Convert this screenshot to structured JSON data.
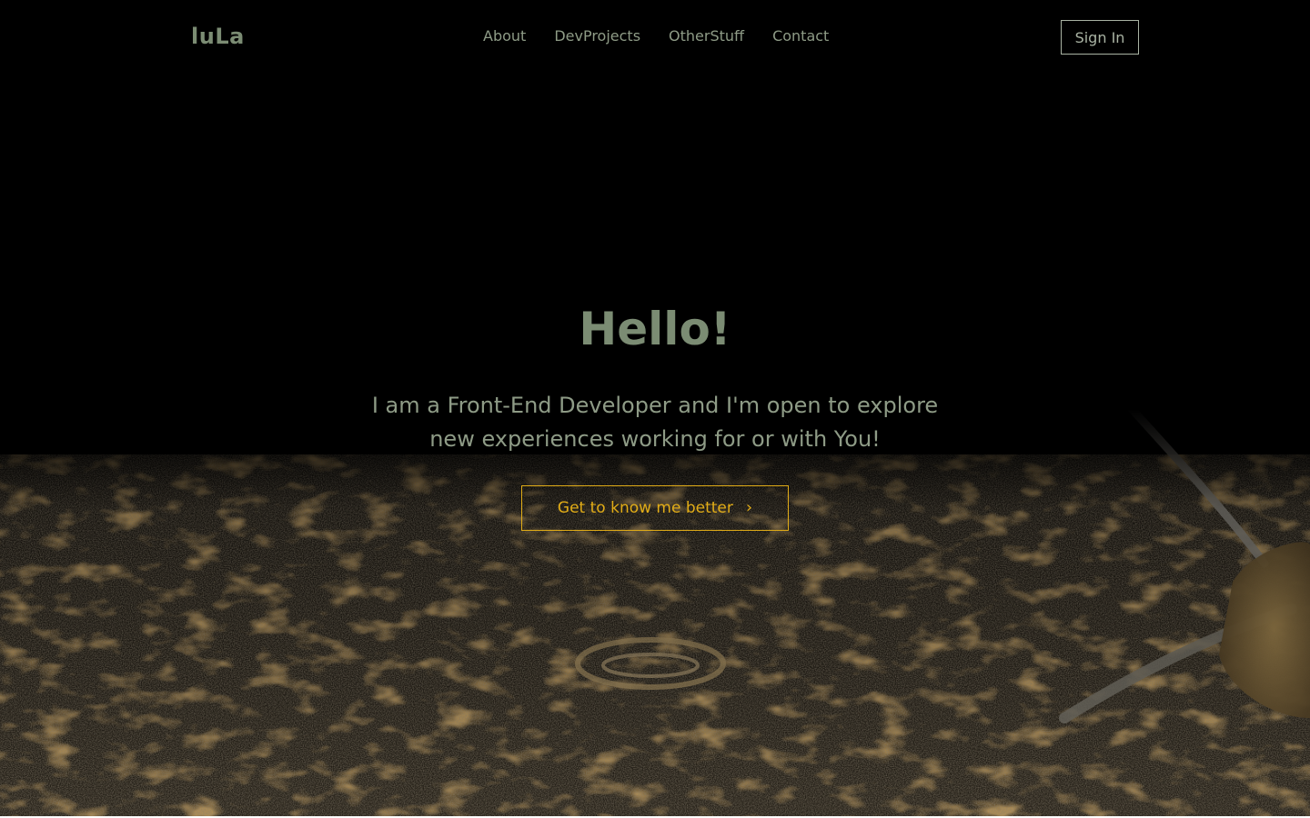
{
  "navbar": {
    "logo": "luLa",
    "links": [
      "About",
      "DevProjects",
      "OtherStuff",
      "Contact"
    ],
    "signin_label": "Sign In"
  },
  "hero": {
    "title": "Hello!",
    "subtitle": "I am a Front-End Developer and I'm open to explore new experiences working for or with You!",
    "cta_label": "Get to know me better",
    "cta_icon": "chevron-right-icon",
    "background": "snail-on-bark-photo"
  },
  "colors": {
    "background": "#000000",
    "accent_green": "#7b8c73",
    "text_green": "#8e9b86",
    "cta_gold": "#e2ad17"
  }
}
